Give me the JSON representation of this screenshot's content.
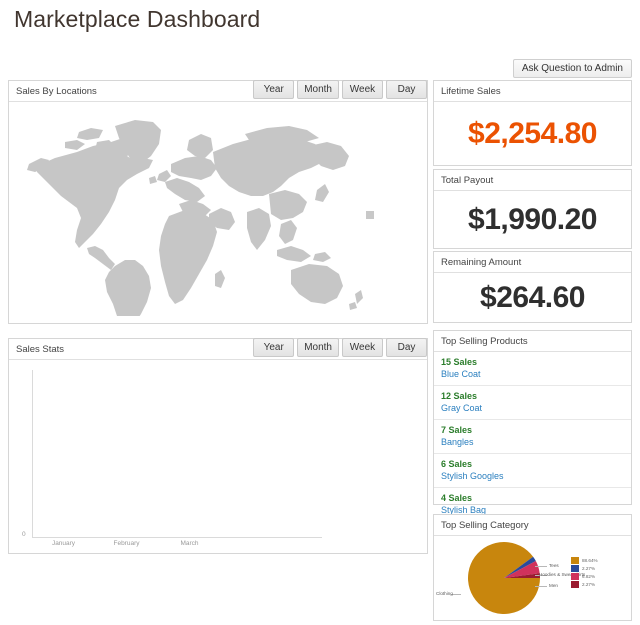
{
  "page": {
    "title": "Marketplace Dashboard",
    "accent_orange": "#eb5202",
    "link_blue": "#2a7fbf",
    "sales_green": "#2b7d2b"
  },
  "toolbar": {
    "ask_admin_label": "Ask Question to Admin"
  },
  "periods": {
    "year": "Year",
    "month": "Month",
    "week": "Week",
    "day": "Day"
  },
  "map_panel": {
    "title": "Sales By Locations"
  },
  "stats_panel": {
    "title": "Sales Stats"
  },
  "cards": {
    "lifetime": {
      "label": "Lifetime Sales",
      "value": "$2,254.80"
    },
    "payout": {
      "label": "Total Payout",
      "value": "$1,990.20"
    },
    "remaining": {
      "label": "Remaining Amount",
      "value": "$264.60"
    }
  },
  "products_panel": {
    "title": "Top Selling Products",
    "items": [
      {
        "sales": "15 Sales",
        "name": "Blue Coat"
      },
      {
        "sales": "12 Sales",
        "name": "Gray Coat"
      },
      {
        "sales": "7 Sales",
        "name": "Bangles"
      },
      {
        "sales": "6 Sales",
        "name": "Stylish Googles"
      },
      {
        "sales": "4 Sales",
        "name": "Stylish Bag"
      }
    ]
  },
  "category_panel": {
    "title": "Top Selling Category"
  },
  "chart_data": [
    {
      "type": "line",
      "title": "Sales Stats",
      "x": [
        "January",
        "February",
        "March"
      ],
      "values": [
        0,
        0,
        0
      ],
      "xlabel": "",
      "ylabel": "",
      "yticks": [
        "0"
      ],
      "ylim": [
        0,
        0
      ],
      "grid": false,
      "legend": "none"
    },
    {
      "type": "pie",
      "title": "Top Selling Category",
      "labels": [
        "Clothing",
        "Tees",
        "Hoodies & Sweatshirts",
        "Men"
      ],
      "values": [
        88.64,
        2.27,
        6.82,
        2.27
      ],
      "legend_labels": [
        "88.64%",
        "2.27%",
        "6.82%",
        "2.27%"
      ],
      "colors": [
        "#c8860d",
        "#2a4b9b",
        "#d0315c",
        "#9b1b30"
      ],
      "legend": "right"
    }
  ]
}
